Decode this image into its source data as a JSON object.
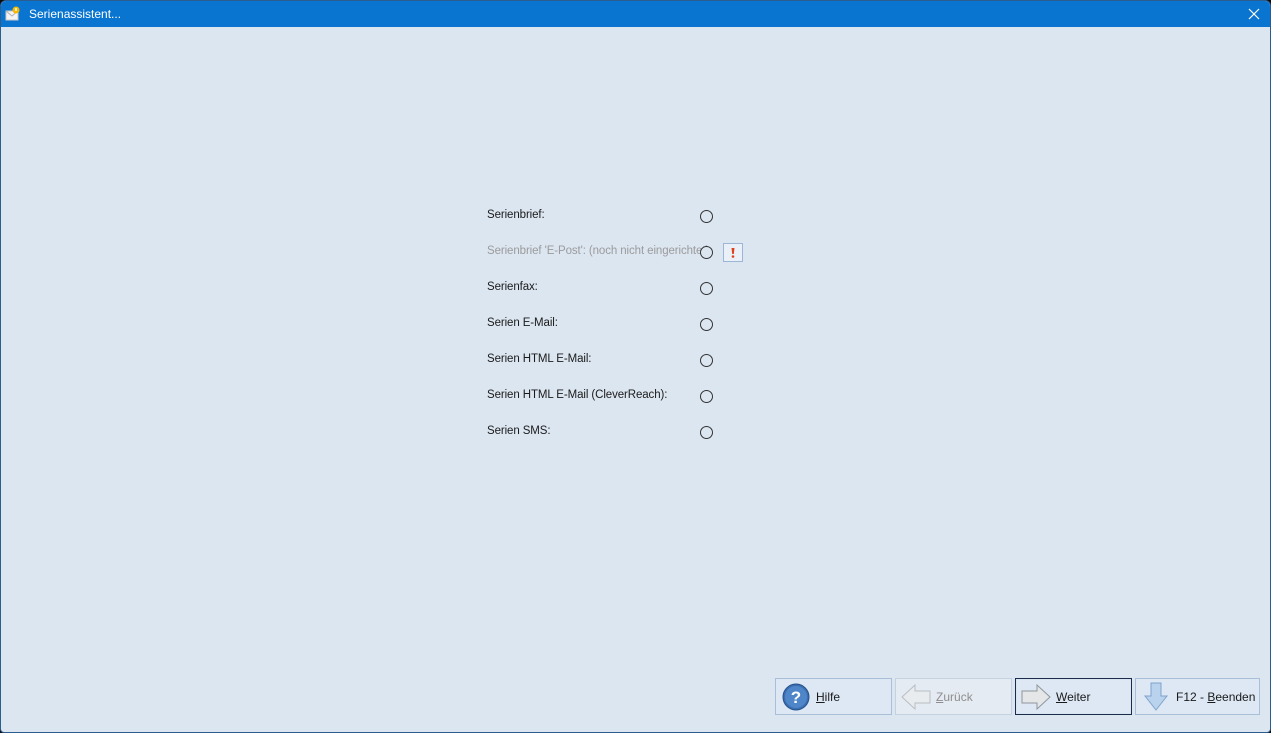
{
  "window": {
    "title": "Serienassistent..."
  },
  "options": [
    {
      "label": "Serienbrief:",
      "disabled": false
    },
    {
      "label": "Serienbrief 'E-Post': (noch nicht eingerichtet)",
      "disabled": true
    },
    {
      "label": "Serienfax:",
      "disabled": false
    },
    {
      "label": "Serien E-Mail:",
      "disabled": false
    },
    {
      "label": "Serien HTML E-Mail:",
      "disabled": false
    },
    {
      "label": "Serien HTML E-Mail (CleverReach):",
      "disabled": false
    },
    {
      "label": "Serien SMS:",
      "disabled": false
    }
  ],
  "info_button": {
    "icon": "exclamation-icon"
  },
  "buttons": {
    "help": {
      "label": "Hilfe",
      "accel": "H",
      "icon": "help-question-icon"
    },
    "back": {
      "label": "Zurück",
      "accel": "Z",
      "icon": "arrow-left-icon",
      "disabled": true
    },
    "next": {
      "label": "Weiter",
      "accel": "W",
      "icon": "arrow-right-icon"
    },
    "exit": {
      "label": "F12 - Beenden",
      "accel": "B",
      "icon": "arrow-down-icon"
    }
  },
  "colors": {
    "titlebar": "#0a75d0",
    "background": "#dce6f1",
    "disabled_text": "#9b9b9b"
  }
}
